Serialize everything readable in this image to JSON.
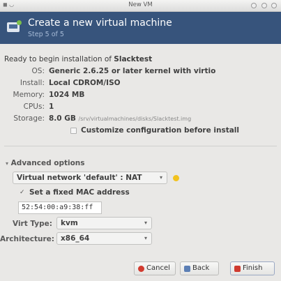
{
  "window": {
    "title": "New VM"
  },
  "banner": {
    "title": "Create a new virtual machine",
    "step": "Step 5 of 5"
  },
  "summary": {
    "intro": "Ready to begin installation of ",
    "vm_name": "Slacktest",
    "rows": [
      {
        "label": "OS:",
        "value": "Generic 2.6.25 or later kernel with virtio"
      },
      {
        "label": "Install:",
        "value": "Local CDROM/ISO"
      },
      {
        "label": "Memory:",
        "value": "1024 MB"
      },
      {
        "label": "CPUs:",
        "value": "1"
      },
      {
        "label": "Storage:",
        "value": "8.0 GB",
        "extra": "/srv/virtualmachines/disks/Slacktest.img"
      }
    ],
    "customize_label": "Customize configuration before install",
    "customize_checked": false
  },
  "advanced": {
    "header": "Advanced options",
    "network_value": "Virtual network 'default' : NAT",
    "mac_checkbox_label": "Set a fixed MAC address",
    "mac_checked": true,
    "mac_value": "52:54:00:a9:38:ff",
    "virt_type_label": "Virt Type:",
    "virt_type_value": "kvm",
    "arch_label": "Architecture:",
    "arch_value": "x86_64"
  },
  "buttons": {
    "cancel": "Cancel",
    "back": "Back",
    "finish": "Finish"
  }
}
